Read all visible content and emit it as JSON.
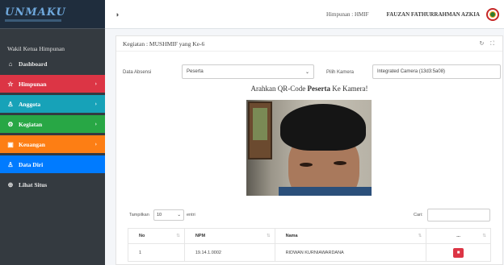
{
  "brand": {
    "name": "UNMAKU"
  },
  "sidebar": {
    "role": "Wakil Ketua Himpunan",
    "items": [
      {
        "label": "Dashboard",
        "icon": "home-icon",
        "color": "#343a40"
      },
      {
        "label": "Himpunan",
        "icon": "star-icon",
        "color": "#dc3545"
      },
      {
        "label": "Anggota",
        "icon": "users-icon",
        "color": "#17a2b8"
      },
      {
        "label": "Kegiatan",
        "icon": "gear-icon",
        "color": "#28a745"
      },
      {
        "label": "Keuangan",
        "icon": "wallet-icon",
        "color": "#fd7e14"
      },
      {
        "label": "Data Diri",
        "icon": "user-icon",
        "color": "#007bff"
      },
      {
        "label": "Lihat Situs",
        "icon": "globe-icon",
        "color": "#343a40"
      }
    ]
  },
  "header": {
    "org": "Himpunan : HMIF",
    "user": "FAUZAN FATHURRAHMAN AZKIA"
  },
  "card": {
    "title": "Kegiatan : MUSHMIF yang Ke-6"
  },
  "form": {
    "absensi_label": "Data Absensi",
    "absensi_value": "Peserta",
    "kamera_label": "Pilih Kamera",
    "kamera_value": "Integrated Camera (13d3:5a08)"
  },
  "prompt": {
    "before": "Arahkan QR-Code ",
    "bold": "Peserta",
    "after": " Ke Kamera!"
  },
  "table_controls": {
    "show_label": "Tampilkan",
    "show_value": "10",
    "entries_label": "entri",
    "search_label": "Cari:"
  },
  "table": {
    "columns": [
      "No",
      "NPM",
      "Nama",
      "..."
    ],
    "rows": [
      {
        "no": "1",
        "npm": "19.14.1.0002",
        "nama": "RIDWAN KURNIAWARDANA"
      }
    ]
  }
}
